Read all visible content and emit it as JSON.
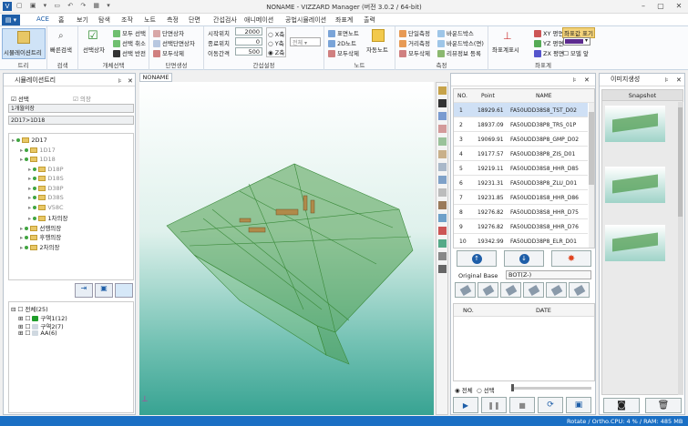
{
  "window": {
    "title": "NONAME - VIZZARD Manager (버전 3.0.2 / 64-bit)"
  },
  "menu": {
    "file": "",
    "tabs": [
      "ACE",
      "홈",
      "보기",
      "탐색",
      "조작",
      "노트",
      "측정",
      "단면",
      "간섭검사",
      "애니메이션",
      "공법시뮬레이션",
      "좌표계",
      "출력"
    ]
  },
  "ribbon": {
    "tree": {
      "label": "시뮬레이션트리",
      "group": "트리"
    },
    "search": {
      "label": "빠른검색",
      "group": "검색"
    },
    "select": {
      "box": "선택상자",
      "all": "모두 선택",
      "cancel": "선택 취소",
      "invert": "선택 반전",
      "group": "개체선택"
    },
    "section": {
      "box": "단면상자",
      "selbox": "선택단면상자",
      "delall": "모두삭제",
      "group": "단면생성"
    },
    "interval": {
      "start_label": "시작위치",
      "start": "2000",
      "end_label": "종료위치",
      "end": "0",
      "step_label": "이동간격",
      "step": "500",
      "x": "X축",
      "y": "Y축",
      "z": "Z축",
      "all": "전체",
      "group": "간섭설정"
    },
    "note": {
      "surface": "표면노트",
      "note2d": "2D노트",
      "delall": "모두삭제",
      "auto": "자동노트",
      "group": "노트"
    },
    "measure": {
      "single": "단일측정",
      "distance": "거리측정",
      "delall": "모두삭제",
      "bbox": "바운드박스",
      "bboxface": "바운드박스(면)",
      "rev": "리뷰정보 등록",
      "group": "측정"
    },
    "coord": {
      "show": "좌표계표시",
      "xy": "XY 평면",
      "yz": "YZ 평면",
      "zx": "ZX 평면",
      "cvalue": "좌표값 표기",
      "modelview": "모델 앞",
      "group": "좌표계"
    }
  },
  "left": {
    "title": "시뮬레이션트리",
    "chk_all": "선택",
    "chk_hull": "의장",
    "field1": "1개월의장",
    "field2": "2D17>1D18",
    "tree": [
      "2D17",
      "1D17",
      "1D18",
      "D18P",
      "D18S",
      "D38P",
      "D38S",
      "V58C",
      "1차의장",
      "선행의장",
      "후행의장",
      "2차의장"
    ],
    "tree2_root": "전체(25)",
    "tree2": [
      "구역1(12)",
      "구역2(7)",
      "AA(6)"
    ]
  },
  "viewport": {
    "tab": "NONAME"
  },
  "table": {
    "cols": [
      "NO.",
      "Point",
      "NAME"
    ],
    "rows": [
      [
        "1",
        "18929.61",
        "FA50UDD38S8_TST_D02"
      ],
      [
        "2",
        "18937.09",
        "FA50UDD38P8_TRS_01P"
      ],
      [
        "3",
        "19069.91",
        "FA50UDD38P8_GMP_D02"
      ],
      [
        "4",
        "19177.57",
        "FA50UDD38P8_ZIS_D01"
      ],
      [
        "5",
        "19219.11",
        "FA50UDD38S8_HHR_D85"
      ],
      [
        "6",
        "19231.31",
        "FA50UDD38P8_ZLU_D01"
      ],
      [
        "7",
        "19231.85",
        "FA50UDD18S8_HHR_D86"
      ],
      [
        "8",
        "19276.82",
        "FA50UDD38S8_HHR_D75"
      ],
      [
        "9",
        "19276.82",
        "FA50UDD38S8_HHR_D76"
      ],
      [
        "10",
        "19342.99",
        "FA50UDD38P8_ELR_D01"
      ]
    ],
    "base_label": "Original Base",
    "base_value": "BOT(Z-)",
    "date_cols": [
      "NO.",
      "DATE"
    ],
    "radio_all": "전체",
    "radio_sel": "선택"
  },
  "right": {
    "title": "이미지생성",
    "snapshot": "Snapshot"
  },
  "status": {
    "text": "Rotate / Ortho.",
    "cpu": "CPU: 4 % / RAM: 485 MB"
  },
  "colors": {
    "accent": "#1e5ea8",
    "status": "#1a6fc4",
    "model": "#3a8a3a"
  }
}
